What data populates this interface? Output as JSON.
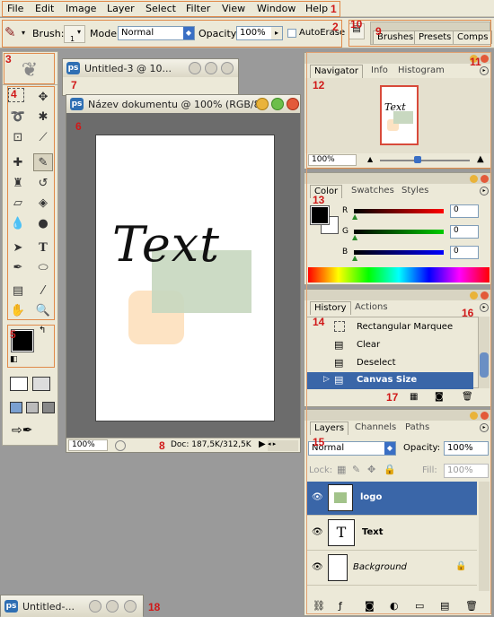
{
  "menu": {
    "items": [
      "File",
      "Edit",
      "Image",
      "Layer",
      "Select",
      "Filter",
      "View",
      "Window",
      "Help"
    ],
    "annotation": "1"
  },
  "options": {
    "brush_label": "Brush:",
    "brush_size": "1",
    "mode_label": "Mode:",
    "mode_value": "Normal",
    "opacity_label": "Opacity:",
    "opacity_value": "100%",
    "autoerase_label": "AutoErase",
    "annotation": "2"
  },
  "wells": {
    "tabs": [
      "Brushes",
      "Presets",
      "Comps"
    ],
    "annotation_left": "10",
    "annotation_right": "9"
  },
  "toolbox": {
    "annotation_logo": "3",
    "annotation_tools": "4",
    "annotation_colors": "5"
  },
  "doc_small": {
    "title": "Untitled-3 @ 10...",
    "annotation": "7"
  },
  "doc_main": {
    "title": "Název dokumentu @ 100% (RGB/8)",
    "canvas_text": "Text",
    "zoom": "100%",
    "doc_info": "Doc: 187,5K/312,5K",
    "annotation_window": "6",
    "annotation_status": "8"
  },
  "doc_min": {
    "title": "Untitled-...",
    "annotation": "18"
  },
  "navigator": {
    "tabs": [
      "Navigator",
      "Info",
      "Histogram"
    ],
    "zoom": "100%",
    "preview_text": "Text",
    "annotation": "12",
    "annotation_dock": "11"
  },
  "color": {
    "tabs": [
      "Color",
      "Swatches",
      "Styles"
    ],
    "channels": [
      {
        "label": "R",
        "value": "0"
      },
      {
        "label": "G",
        "value": "0"
      },
      {
        "label": "B",
        "value": "0"
      }
    ],
    "annotation": "13"
  },
  "history": {
    "tabs": [
      "History",
      "Actions"
    ],
    "items": [
      "Rectangular Marquee",
      "Clear",
      "Deselect",
      "Canvas Size"
    ],
    "annotation_list": "14",
    "annotation_menu": "16",
    "annotation_buttons": "17"
  },
  "layers": {
    "tabs": [
      "Layers",
      "Channels",
      "Paths"
    ],
    "blend_mode": "Normal",
    "opacity_label": "Opacity:",
    "opacity_value": "100%",
    "lock_label": "Lock:",
    "fill_label": "Fill:",
    "fill_value": "100%",
    "items": [
      "logo",
      "Text",
      "Background"
    ],
    "annotation": "15"
  },
  "colors": {
    "annotation": "#d01818",
    "selection": "#3a66a8",
    "canvas_bg": "#6c6c6c",
    "peach": "#fde3c3",
    "sage": "#c8d8c0"
  }
}
